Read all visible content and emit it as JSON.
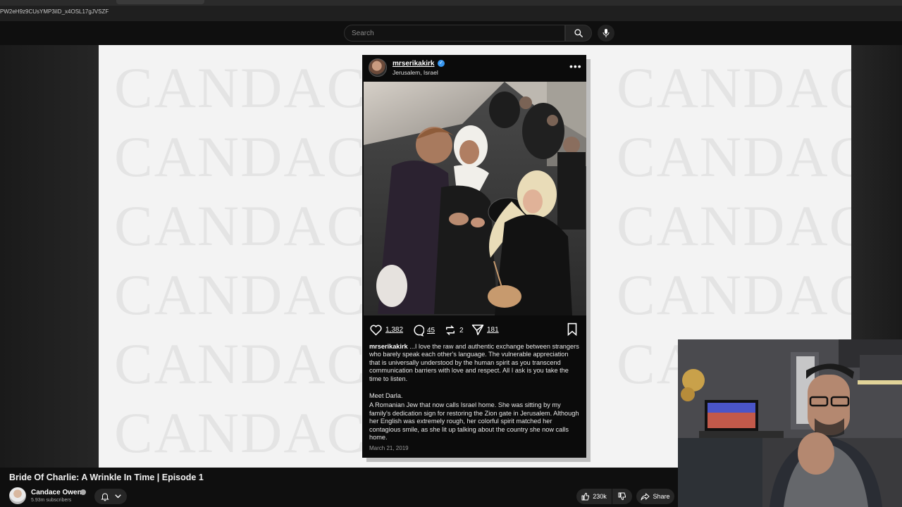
{
  "browser": {
    "url": "PW2eH9z9CUsYMP3iID_x4OSL17gJVSZF"
  },
  "masthead": {
    "search_placeholder": "Search"
  },
  "slide": {
    "watermark_text": "CANDACE"
  },
  "instagram_post": {
    "username": "mrserikakirk",
    "location": "Jerusalem, Israel",
    "likes": "1,382",
    "comments": "45",
    "reposts": "2",
    "shares": "181",
    "caption_user": "mrserikakirk",
    "caption_text": " ...I love the raw and authentic exchange between strangers who barely speak each other's language. The vulnerable appreciation that is universally understood by the human spirit as you transcend communication barriers with love and respect. All I ask is you take the time to listen.",
    "meet_heading": "Meet Darla.",
    "meet_text": "A Romanian Jew that now calls Israel home. She was sitting by my family's dedication sign for restoring the Zion gate in Jerusalem. Although her English was extremely rough, her colorful spirit matched her contagious smile, as she lit up talking about the country she now calls home.",
    "date": "March 21, 2019"
  },
  "video": {
    "title": "Bride Of Charlie: A Wrinkle In Time | Episode 1",
    "channel_name": "Candace Owens",
    "subscribers": "5.93m subscribers",
    "likes": "230k",
    "share_label": "Share"
  },
  "colors": {
    "background": "#0f0f0f",
    "slide_bg": "#f3f3f3",
    "watermark": "#e4e4e4",
    "ig_verified": "#3897f0"
  }
}
